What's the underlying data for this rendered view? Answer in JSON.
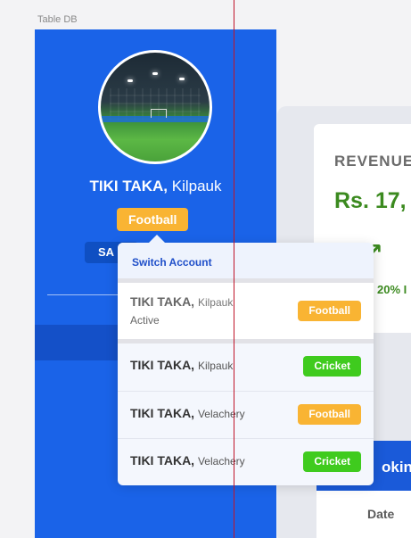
{
  "frame_label": "Table DB",
  "venue": {
    "name": "TIKI TAKA,",
    "location": "Kilpauk",
    "sport": "Football"
  },
  "sidebar": {
    "pill_text": "SA"
  },
  "revenue": {
    "label": "REVENUE",
    "amount": "Rs. 17,",
    "change": "20% I",
    "arrow": "↗"
  },
  "bookings": {
    "title": "oking",
    "column_date": "Date"
  },
  "switch_account": {
    "header": "Switch Account",
    "accounts": [
      {
        "name": "TIKI TAKA,",
        "location": "Kilpauk",
        "sport": "Football",
        "status": "Active"
      },
      {
        "name": "TIKI TAKA,",
        "location": "Kilpauk",
        "sport": "Cricket"
      },
      {
        "name": "TIKI TAKA,",
        "location": "Velachery",
        "sport": "Football"
      },
      {
        "name": "TIKI TAKA,",
        "location": "Velachery",
        "sport": "Cricket"
      }
    ]
  },
  "colors": {
    "sidebar_blue": "#1a63e8",
    "football_badge": "#f9b433",
    "cricket_badge": "#3fcb1e",
    "revenue_green": "#3b8a1f",
    "guide_line": "#c0142a"
  }
}
